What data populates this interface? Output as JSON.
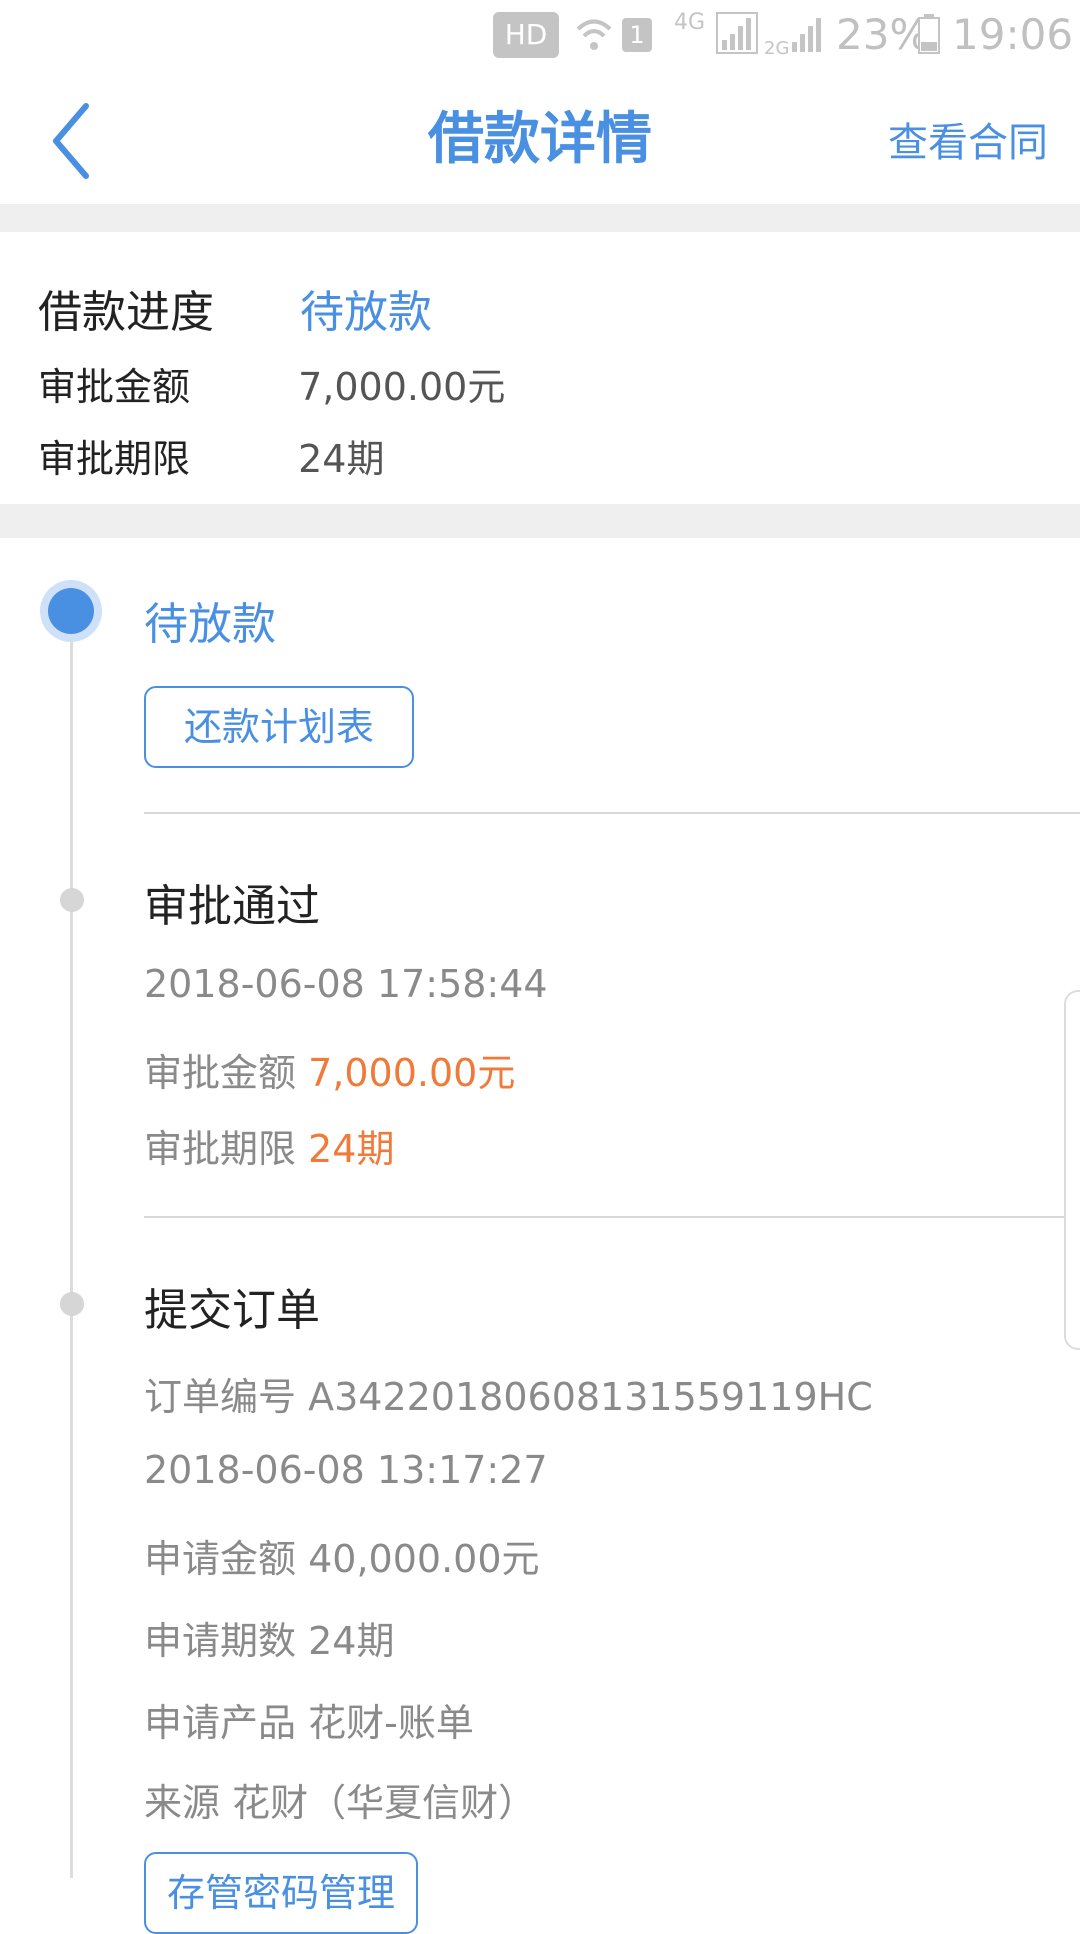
{
  "status_bar": {
    "hd": "HD",
    "sim": "1",
    "network_1": "4G",
    "network_2": "2G",
    "battery": "23%",
    "time": "19:06"
  },
  "header": {
    "title": "借款详情",
    "contract_link": "查看合同"
  },
  "summary": {
    "progress_label": "借款进度",
    "progress_value": "待放款",
    "amount_label": "审批金额",
    "amount_value": "7,000.00元",
    "term_label": "审批期限",
    "term_value": "24期"
  },
  "timeline": {
    "pending": {
      "title": "待放款",
      "button": "还款计划表"
    },
    "approved": {
      "title": "审批通过",
      "datetime": "2018-06-08 17:58:44",
      "amount_label": "审批金额",
      "amount_value": "7,000.00元",
      "term_label": "审批期限",
      "term_value": "24期"
    },
    "submitted": {
      "title": "提交订单",
      "order_label": "订单编号",
      "order_value": "A3422018060813155911​9HC",
      "datetime": "2018-06-08 13:17:27",
      "apply_amount_label": "申请金额",
      "apply_amount_value": "40,000.00元",
      "apply_term_label": "申请期数",
      "apply_term_value": "24期",
      "product_label": "申请产品",
      "product_value": "花财-账单",
      "source_label": "来源",
      "source_value": "花财（华夏信财）",
      "button": "存管密码管理"
    }
  },
  "colors": {
    "accent": "#4a90e2",
    "highlight": "#f07a3a"
  }
}
